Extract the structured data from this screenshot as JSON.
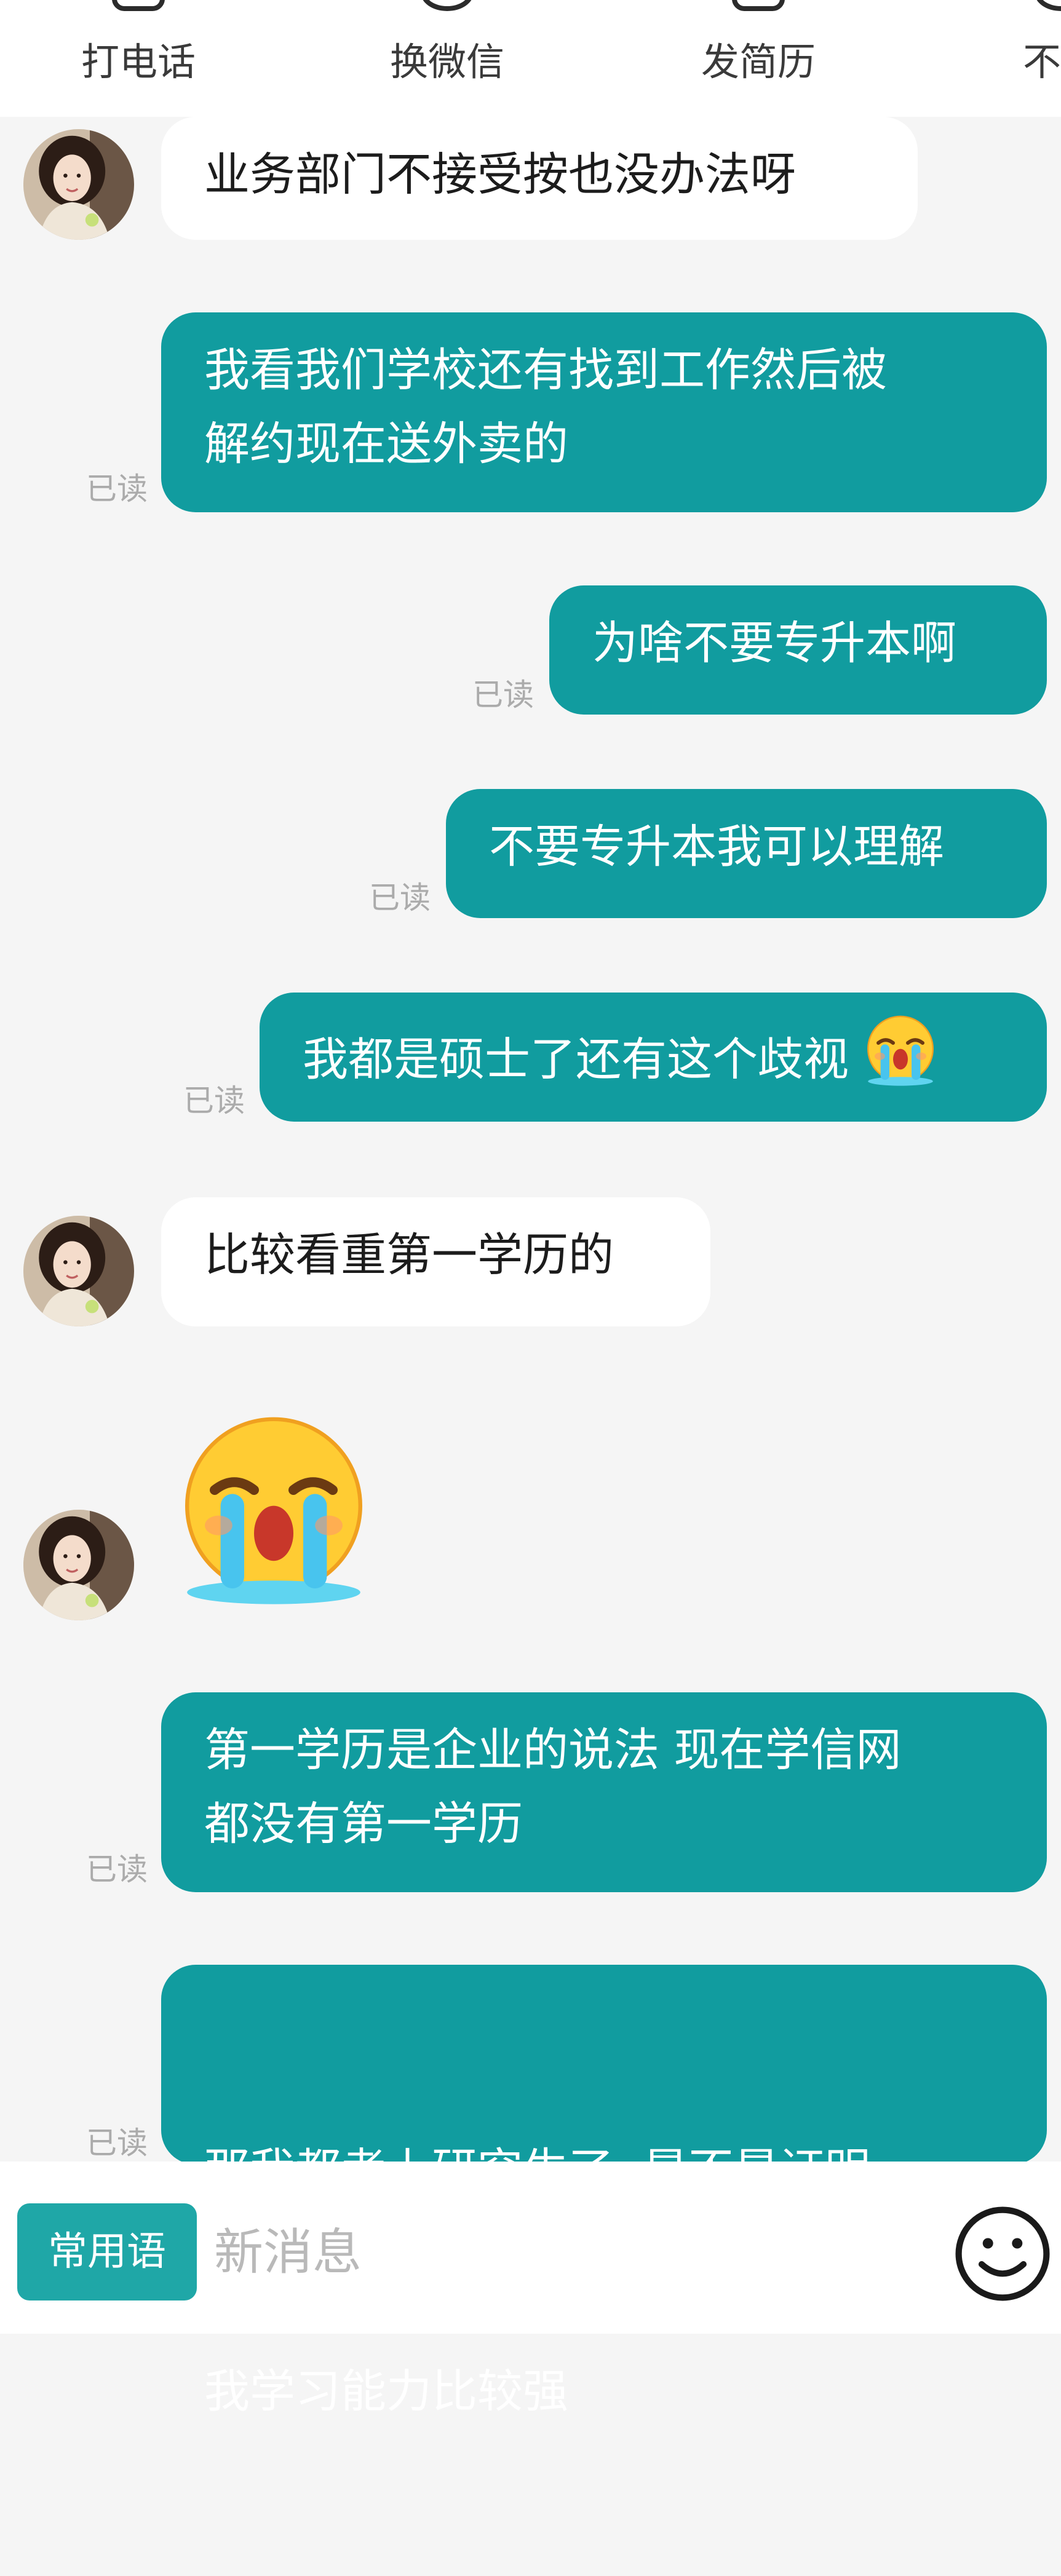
{
  "actions": [
    {
      "label": "打电话",
      "icon": "phone-icon"
    },
    {
      "label": "换微信",
      "icon": "wechat-icon"
    },
    {
      "label": "发简历",
      "icon": "resume-icon"
    },
    {
      "label": "不感",
      "icon": "dislike-icon"
    }
  ],
  "messages": [
    {
      "from": "them",
      "text": "业务部门不接受按也没办法呀"
    },
    {
      "from": "me",
      "lines": [
        "我看我们学校还有找到工作然后被",
        "解约现在送外卖的"
      ],
      "status": "已读"
    },
    {
      "from": "me",
      "text": "为啥不要专升本啊",
      "status": "已读"
    },
    {
      "from": "me",
      "text": "不要专升本我可以理解",
      "status": "已读"
    },
    {
      "from": "me",
      "text": "我都是硕士了还有这个歧视",
      "emoji": "loudly-crying-face",
      "status": "已读"
    },
    {
      "from": "them",
      "text": "比较看重第一学历的"
    },
    {
      "from": "them",
      "emoji": "loudly-crying-face"
    },
    {
      "from": "me",
      "lines": [
        "第一学历是企业的说法 现在学信网",
        "都没有第一学历"
      ],
      "status": "已读"
    },
    {
      "from": "me",
      "lines": [
        "那我都考上研究生了  是不是证明",
        "我学习能力比较强"
      ],
      "status": "已读"
    }
  ],
  "input": {
    "phrases_label": "常用语",
    "placeholder": "新消息",
    "emoji_icon": "smiley-icon"
  },
  "colors": {
    "sent_bubble": "#119c9f",
    "received_bubble": "#ffffff",
    "phrases_button": "#1fa7a7",
    "background": "#f5f5f5"
  }
}
